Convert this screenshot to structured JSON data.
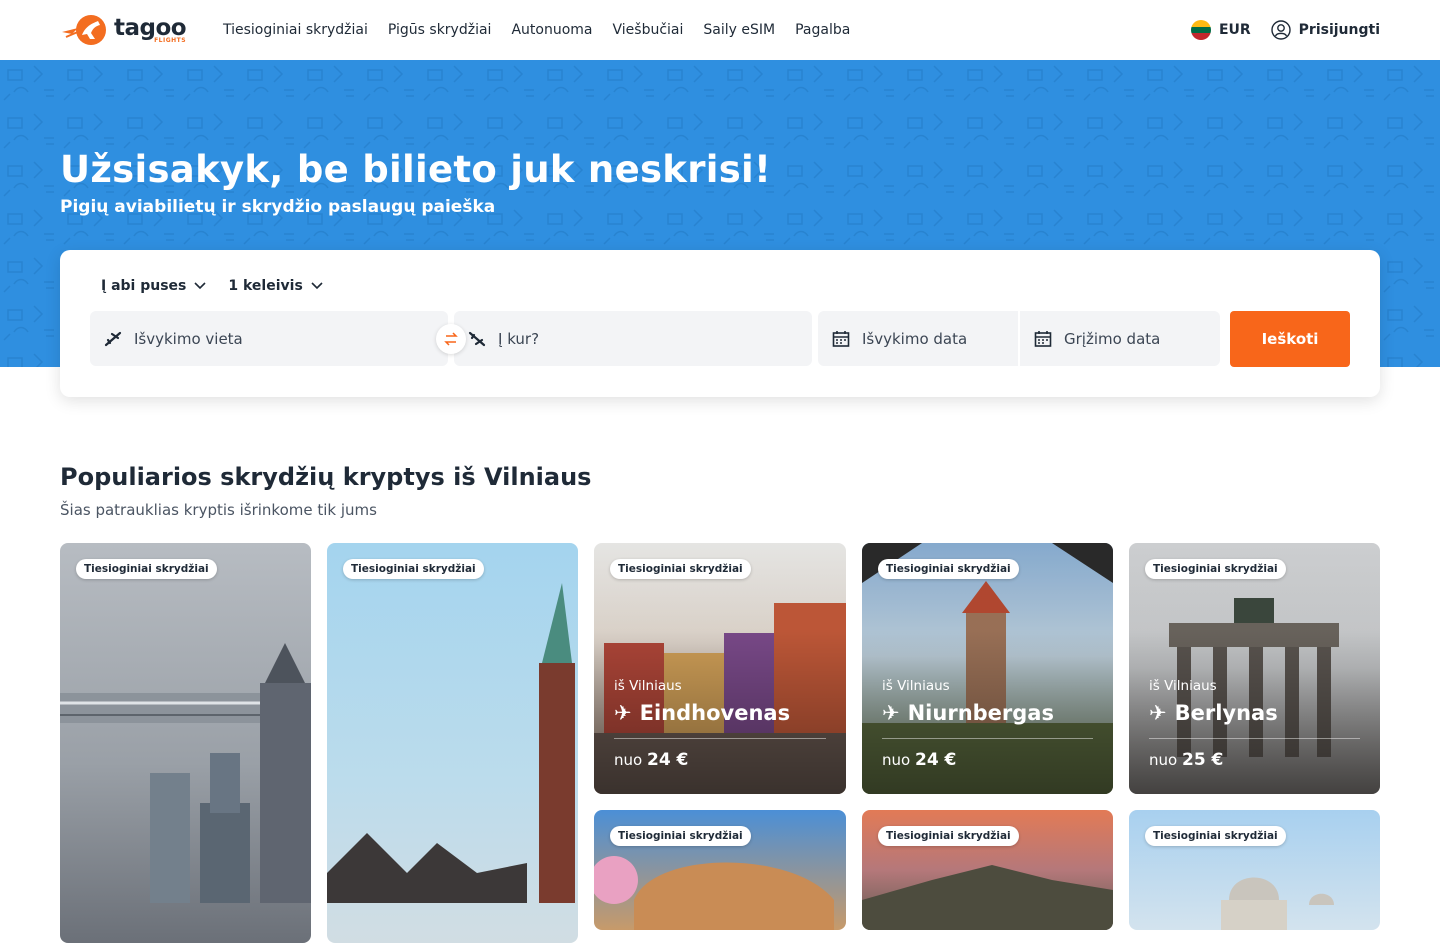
{
  "header": {
    "logo_name": "tagoo",
    "logo_sub": "FLIGHTS",
    "nav": [
      "Tiesioginiai skrydžiai",
      "Pigūs skrydžiai",
      "Autonuoma",
      "Viešbučiai",
      "Saily eSIM",
      "Pagalba"
    ],
    "currency": "EUR",
    "login": "Prisijungti"
  },
  "hero": {
    "title": "Užsisakyk, be bilieto juk neskrisi!",
    "subtitle": "Pigių aviabilietų ir skrydžio paslaugų paieška"
  },
  "search": {
    "trip_type": "Į abi puses",
    "passengers": "1 keleivis",
    "from_placeholder": "Išvykimo vieta",
    "to_placeholder": "Į kur?",
    "departure_placeholder": "Išvykimo data",
    "return_placeholder": "Grįžimo data",
    "button": "Ieškoti"
  },
  "section": {
    "title": "Populiarios skrydžių kryptys iš Vilniaus",
    "subtitle": "Šias patrauklias kryptis išrinkome tik jums"
  },
  "cards": [
    {
      "badge": "Tiesioginiai skrydžiai"
    },
    {
      "badge": "Tiesioginiai skrydžiai"
    },
    {
      "badge": "Tiesioginiai skrydžiai",
      "from": "iš Vilniaus",
      "city": "Eindhovenas",
      "price_prefix": "nuo",
      "price": "24 €"
    },
    {
      "badge": "Tiesioginiai skrydžiai",
      "from": "iš Vilniaus",
      "city": "Niurnbergas",
      "price_prefix": "nuo",
      "price": "24 €"
    },
    {
      "badge": "Tiesioginiai skrydžiai",
      "from": "iš Vilniaus",
      "city": "Berlynas",
      "price_prefix": "nuo",
      "price": "25 €"
    },
    {
      "badge": "Tiesioginiai skrydžiai"
    },
    {
      "badge": "Tiesioginiai skrydžiai"
    },
    {
      "badge": "Tiesioginiai skrydžiai"
    }
  ],
  "colors": {
    "accent": "#f8661a",
    "hero_blue": "#2f8fe0"
  }
}
